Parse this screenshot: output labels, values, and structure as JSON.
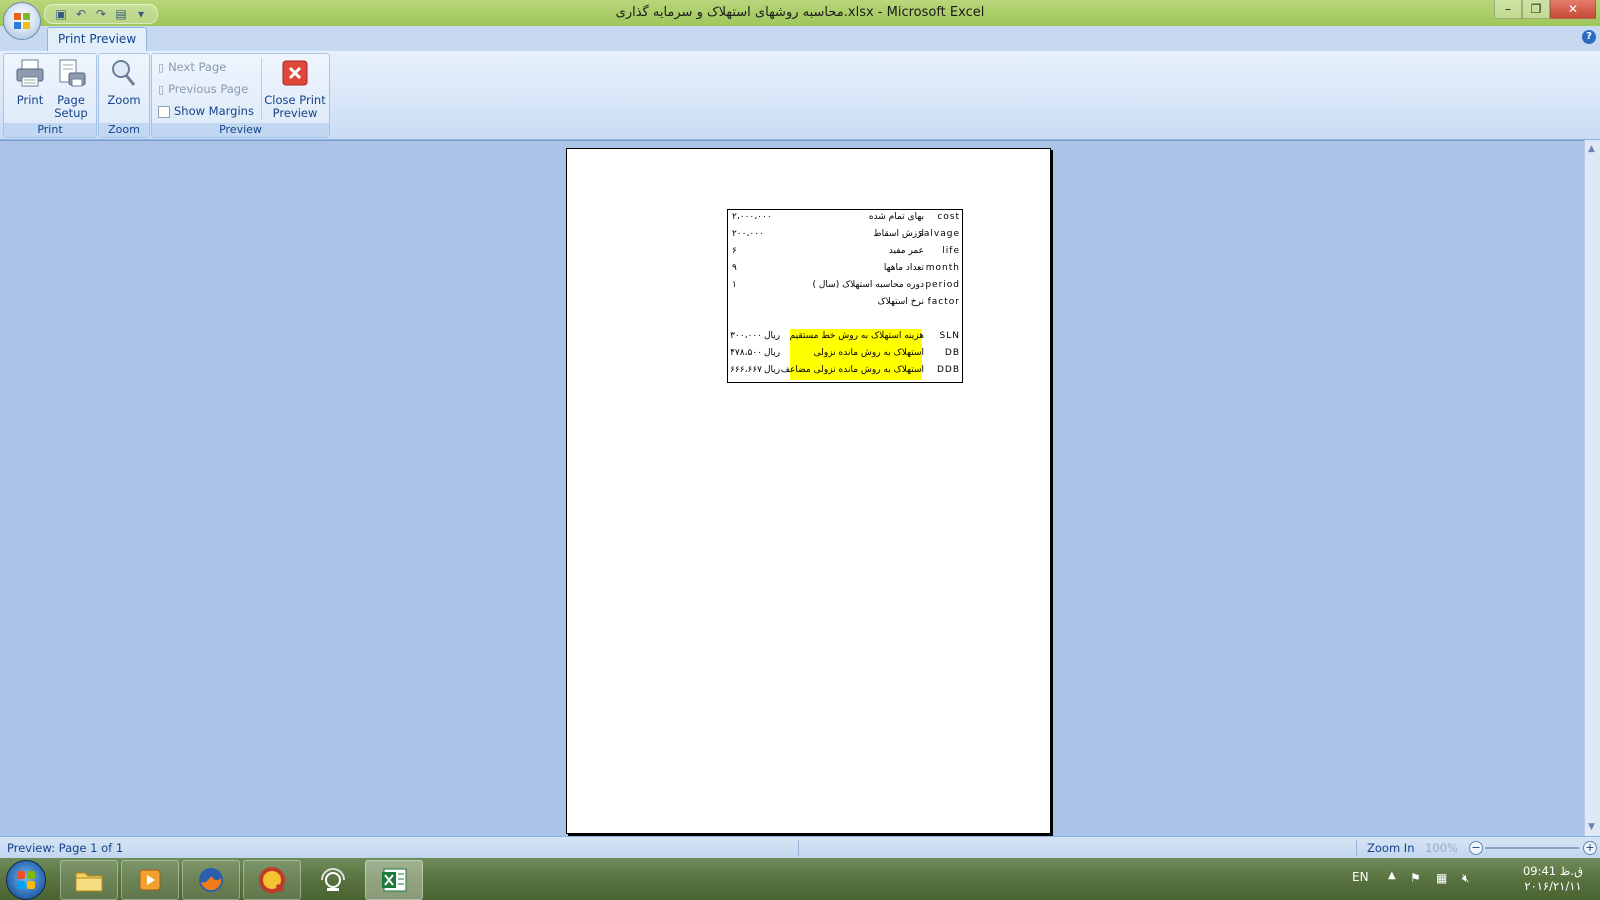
{
  "window": {
    "title": "محاسبه روشهای استهلاک و سرمایه گذاری.xlsx - Microsoft Excel"
  },
  "ribbon": {
    "active_tab": "Print Preview",
    "groups": {
      "print": {
        "label": "Print",
        "print_btn": "Print",
        "page_setup_btn_line1": "Page",
        "page_setup_btn_line2": "Setup"
      },
      "zoom": {
        "label": "Zoom",
        "zoom_btn": "Zoom"
      },
      "preview": {
        "label": "Preview",
        "next_page": "Next Page",
        "previous_page": "Previous Page",
        "show_margins": "Show Margins",
        "close_line1": "Close Print",
        "close_line2": "Preview"
      }
    }
  },
  "sheet": {
    "rows": [
      {
        "key": "cost",
        "label": "بهای تمام شده",
        "value": "۲،۰۰۰،۰۰۰",
        "unit": ""
      },
      {
        "key": "salvage",
        "label": "ارزش اسقاط",
        "value": "۲۰۰،۰۰۰",
        "unit": ""
      },
      {
        "key": "life",
        "label": "عمر مفید",
        "value": "۶",
        "unit": ""
      },
      {
        "key": "month",
        "label": "تعداد ماهها",
        "value": "۹",
        "unit": ""
      },
      {
        "key": "period",
        "label": "دوره محاسبه استهلاک (سال )",
        "value": "۱",
        "unit": ""
      },
      {
        "key": "factor",
        "label": "نرخ استهلاک",
        "value": "",
        "unit": ""
      },
      {
        "key": "",
        "label": "",
        "value": "",
        "unit": ""
      },
      {
        "key": "SLN",
        "label": "هزینه استهلاک به روش خط مستقیم",
        "value": "۳۰۰،۰۰۰",
        "unit": "ریال"
      },
      {
        "key": "DB",
        "label": "استهلاک به روش مانده نزولی",
        "value": "۴۷۸،۵۰۰",
        "unit": "ریال"
      },
      {
        "key": "DDB",
        "label": "استهلاک به روش مانده نزولی مضاعف",
        "value": "۶۶۶،۶۶۷",
        "unit": "ریال"
      }
    ],
    "highlight_color": "#ffff00"
  },
  "statusbar": {
    "preview_text": "Preview: Page 1 of 1",
    "zoom_in_label": "Zoom In",
    "zoom_percent": "100%"
  },
  "taskbar": {
    "apps": [
      "explorer-icon",
      "media-player-icon",
      "firefox-icon",
      "quicktime-icon",
      "network-icon",
      "excel-icon"
    ],
    "language": "EN",
    "time": "ق.ظ 09:41",
    "date": "۲۰۱۶/۲۱/۱۱"
  }
}
